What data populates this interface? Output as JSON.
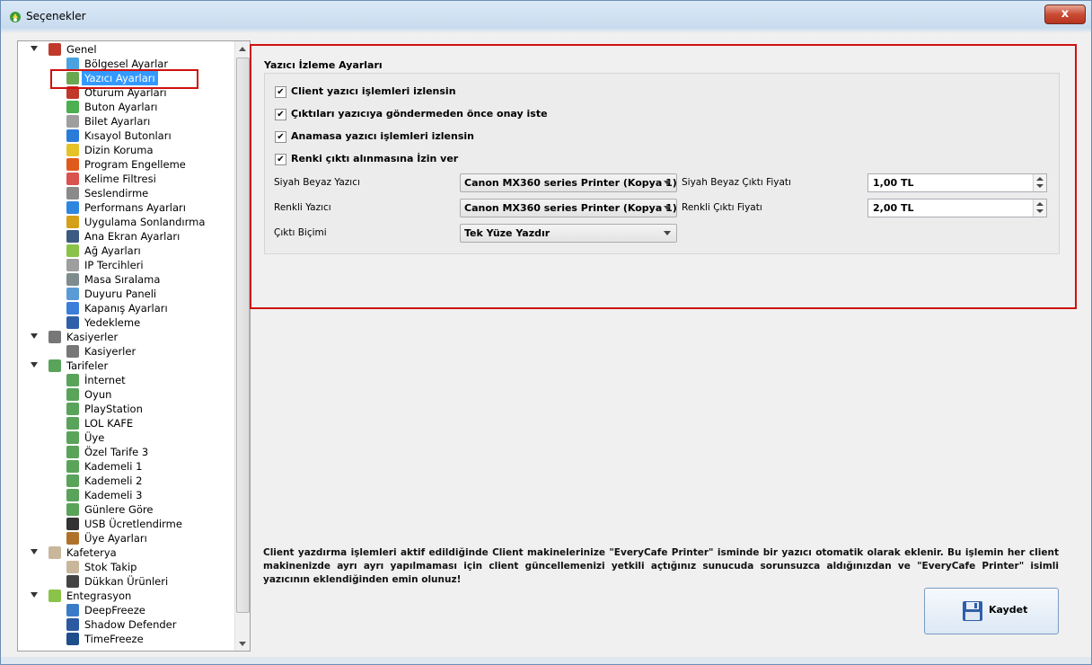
{
  "window": {
    "title": "Seçenekler",
    "close_label": "x"
  },
  "tree": {
    "items": [
      {
        "label": "Genel",
        "level": 0,
        "expanded": true,
        "icon": "tools-icon"
      },
      {
        "label": "Bölgesel Ayarlar",
        "level": 1,
        "icon": "globe-icon"
      },
      {
        "label": "Yazıcı Ayarları",
        "level": 1,
        "icon": "printer-icon",
        "selected": true
      },
      {
        "label": "Oturum Ayarları",
        "level": 1,
        "icon": "tools-icon"
      },
      {
        "label": "Buton Ayarları",
        "level": 1,
        "icon": "check-circle-icon"
      },
      {
        "label": "Bilet Ayarları",
        "level": 1,
        "icon": "ticket-printer-icon"
      },
      {
        "label": "Kısayol Butonları",
        "level": 1,
        "icon": "play-circle-icon"
      },
      {
        "label": "Dizin Koruma",
        "level": 1,
        "icon": "folder-shield-icon"
      },
      {
        "label": "Program Engelleme",
        "level": 1,
        "icon": "forbidden-icon"
      },
      {
        "label": "Kelime Filtresi",
        "level": 1,
        "icon": "document-x-icon"
      },
      {
        "label": "Seslendirme",
        "level": 1,
        "icon": "speaker-icon"
      },
      {
        "label": "Performans Ayarları",
        "level": 1,
        "icon": "puzzle-icon"
      },
      {
        "label": "Uygulama Sonlandırma",
        "level": 1,
        "icon": "broom-icon"
      },
      {
        "label": "Ana Ekran Ayarları",
        "level": 1,
        "icon": "monitor-icon"
      },
      {
        "label": "Ağ Ayarları",
        "level": 1,
        "icon": "network-icon"
      },
      {
        "label": "IP Tercihleri",
        "level": 1,
        "icon": "ip-icon"
      },
      {
        "label": "Masa Sıralama",
        "level": 1,
        "icon": "grid-icon"
      },
      {
        "label": "Duyuru Paneli",
        "level": 1,
        "icon": "envelope-icon"
      },
      {
        "label": "Kapanış Ayarları",
        "level": 1,
        "icon": "shutdown-icon"
      },
      {
        "label": "Yedekleme",
        "level": 1,
        "icon": "floppy-icon"
      },
      {
        "label": "Kasiyerler",
        "level": 0,
        "expanded": true,
        "icon": "user-icon"
      },
      {
        "label": "Kasiyerler",
        "level": 1,
        "icon": "user-icon"
      },
      {
        "label": "Tarifeler",
        "level": 0,
        "expanded": true,
        "icon": "tariff-icon"
      },
      {
        "label": "İnternet",
        "level": 1,
        "icon": "tariff-icon"
      },
      {
        "label": "Oyun",
        "level": 1,
        "icon": "tariff-icon"
      },
      {
        "label": "PlayStation",
        "level": 1,
        "icon": "tariff-icon"
      },
      {
        "label": "LOL KAFE",
        "level": 1,
        "icon": "tariff-icon"
      },
      {
        "label": "Üye",
        "level": 1,
        "icon": "tariff-icon"
      },
      {
        "label": "Özel Tarife 3",
        "level": 1,
        "icon": "tariff-icon"
      },
      {
        "label": "Kademeli 1",
        "level": 1,
        "icon": "tariff-icon"
      },
      {
        "label": "Kademeli 2",
        "level": 1,
        "icon": "tariff-icon"
      },
      {
        "label": "Kademeli 3",
        "level": 1,
        "icon": "tariff-icon"
      },
      {
        "label": "Günlere Göre",
        "level": 1,
        "icon": "tariff-icon"
      },
      {
        "label": "USB Ücretlendirme",
        "level": 1,
        "icon": "usb-icon"
      },
      {
        "label": "Üye Ayarları",
        "level": 1,
        "icon": "member-icon"
      },
      {
        "label": "Kafeterya",
        "level": 0,
        "expanded": true,
        "icon": "cup-icon"
      },
      {
        "label": "Stok Takip",
        "level": 1,
        "icon": "cup-icon"
      },
      {
        "label": "Dükkan Ürünleri",
        "level": 1,
        "icon": "cart-icon"
      },
      {
        "label": "Entegrasyon",
        "level": 0,
        "expanded": true,
        "icon": "network-icon"
      },
      {
        "label": "DeepFreeze",
        "level": 1,
        "icon": "deepfreeze-icon"
      },
      {
        "label": "Shadow Defender",
        "level": 1,
        "icon": "shadow-defender-icon"
      },
      {
        "label": "TimeFreeze",
        "level": 1,
        "icon": "timefreeze-icon"
      }
    ]
  },
  "printer": {
    "group_title": "Yazıcı İzleme Ayarları",
    "checkboxes": [
      {
        "label": "Client yazıcı işlemleri izlensin",
        "checked": true
      },
      {
        "label": "Çıktıları yazıcıya göndermeden önce onay iste",
        "checked": true
      },
      {
        "label": "Anamasa yazıcı işlemleri izlensin",
        "checked": true
      },
      {
        "label": "Renki çıktı alınmasına İzin ver",
        "checked": true
      }
    ],
    "bw_printer_label": "Siyah Beyaz Yazıcı",
    "bw_printer_value": "Canon MX360 series Printer (Kopya 1)",
    "bw_price_label": "Siyah Beyaz Çıktı Fiyatı",
    "bw_price_value": "1,00 TL",
    "color_printer_label": "Renkli Yazıcı",
    "color_printer_value": "Canon MX360 series Printer (Kopya 1)",
    "color_price_label": "Renkli Çıktı Fiyatı",
    "color_price_value": "2,00 TL",
    "output_format_label": "Çıktı Biçimi",
    "output_format_value": "Tek Yüze Yazdır"
  },
  "info_text": "Client yazdırma işlemleri aktif edildiğinde Client makinelerinize \"EveryCafe Printer\" isminde bir yazıcı otomatik olarak eklenir. Bu işlemin her client makinenizde ayrı ayrı yapılmaması için client güncellemenizi yetkili açtığınız sunucuda sorunsuzca aldığınızdan ve \"EveryCafe Printer\" isimli yazıcının eklendiğinden emin olunuz!",
  "save_label": "Kaydet",
  "colors": {
    "accent_red": "#d01010",
    "selection_blue": "#3399ff"
  }
}
